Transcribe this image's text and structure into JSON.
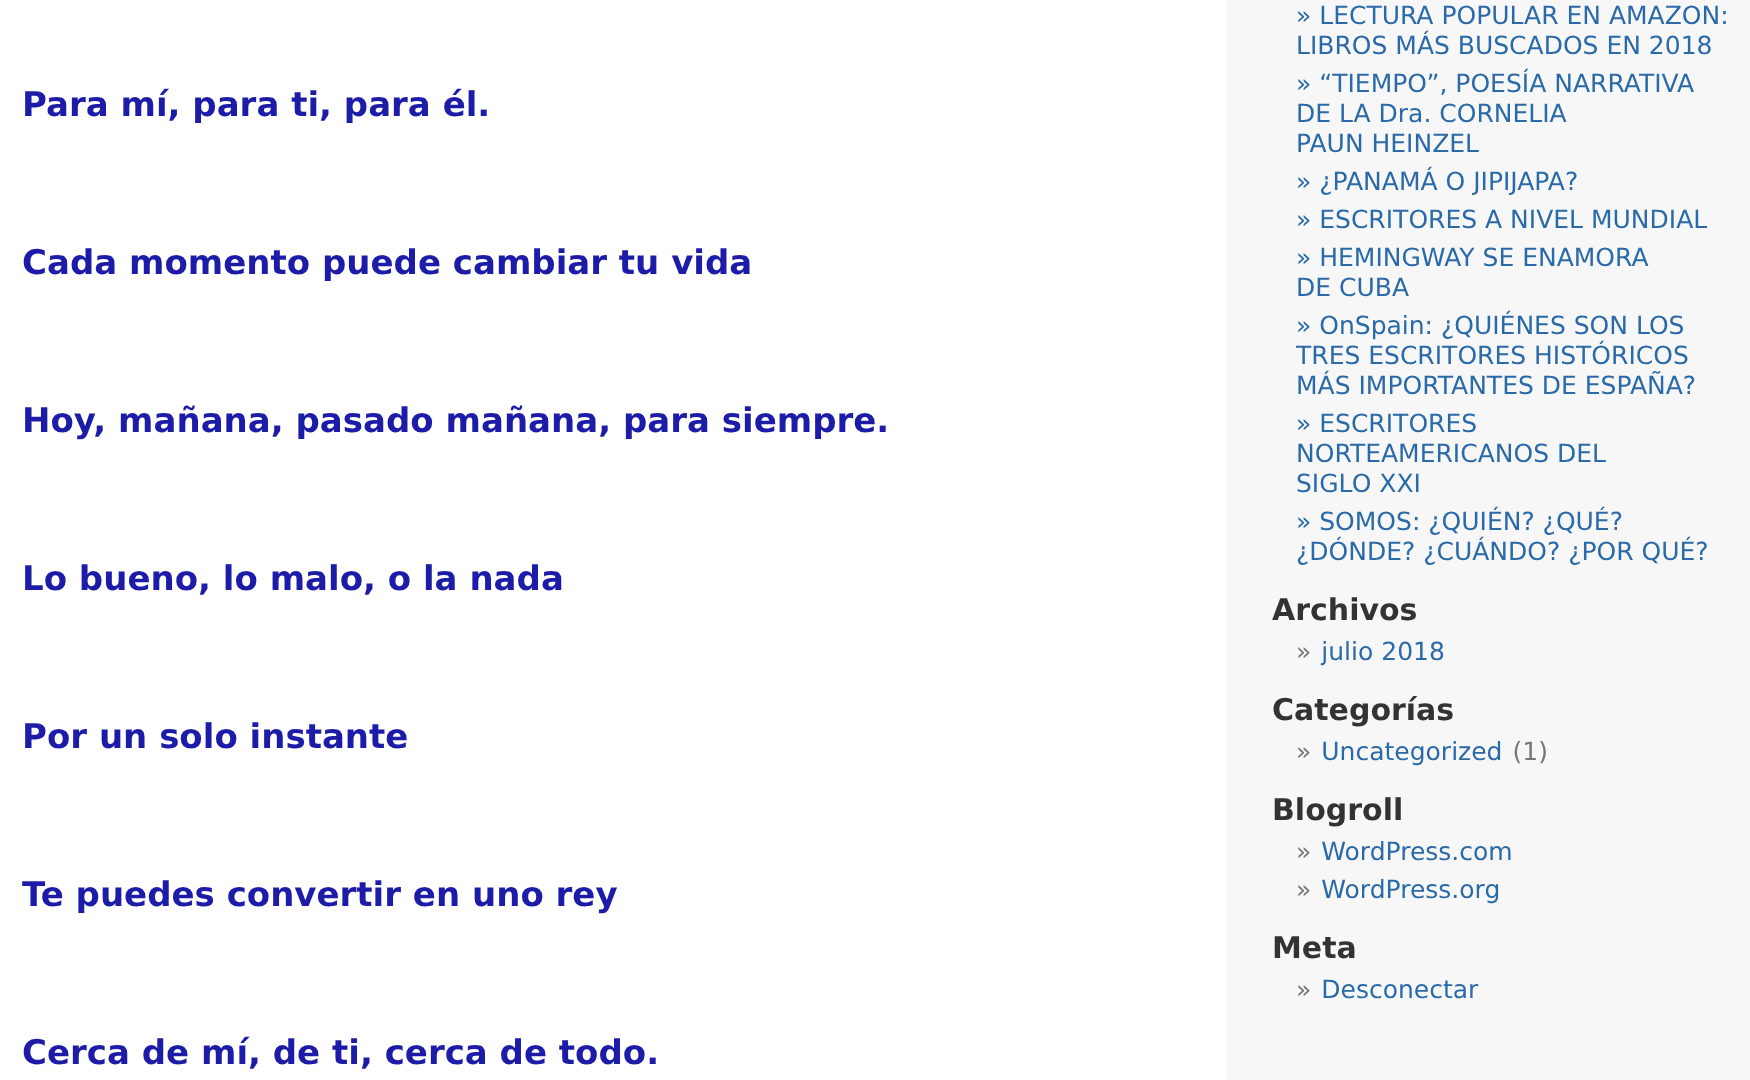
{
  "verses": [
    "Para mí, para ti, para él.",
    "Cada momento puede cambiar tu vida",
    "Hoy, mañana, pasado mañana, para siempre.",
    "Lo bueno, lo malo, o la nada",
    "Por un solo instante",
    "Te puedes convertir en uno rey",
    "Cerca de mí, de ti, cerca de todo."
  ],
  "sidebar": {
    "recent_posts": [
      {
        "lines": [
          "» LECTURA POPULAR EN AMAZON:",
          "LIBROS MÁS BUSCADOS EN 2018"
        ]
      },
      {
        "lines": [
          "» “TIEMPO”, POESÍA NARRATIVA",
          "DE LA Dra. CORNELIA",
          "PAUN HEINZEL"
        ]
      },
      {
        "lines": [
          "» ¿PANAMÁ O JIPIJAPA?"
        ]
      },
      {
        "lines": [
          "» ESCRITORES A NIVEL MUNDIAL"
        ]
      },
      {
        "lines": [
          "» HEMINGWAY SE ENAMORA",
          "DE CUBA"
        ]
      },
      {
        "lines": [
          "» OnSpain: ¿QUIÉNES SON LOS",
          "TRES ESCRITORES HISTÓRICOS",
          "MÁS IMPORTANTES DE ESPAÑA?"
        ]
      },
      {
        "lines": [
          "» ESCRITORES",
          "NORTEAMERICANOS DEL",
          "SIGLO XXI"
        ]
      },
      {
        "lines": [
          "» SOMOS: ¿QUIÉN? ¿QUÉ?",
          "¿DÓNDE? ¿CUÁNDO? ¿POR QUÉ?"
        ]
      }
    ],
    "sections": [
      {
        "title": "Archivos",
        "items": [
          {
            "bullet": "»",
            "label": "julio 2018"
          }
        ]
      },
      {
        "title": "Categorías",
        "items": [
          {
            "bullet": "»",
            "label": "Uncategorized",
            "count": "(1)"
          }
        ]
      },
      {
        "title": "Blogroll",
        "items": [
          {
            "bullet": "»",
            "label": "WordPress.com"
          },
          {
            "bullet": "»",
            "label": "WordPress.org"
          }
        ]
      },
      {
        "title": "Meta",
        "items": [
          {
            "bullet": "»",
            "label": "Desconectar"
          }
        ]
      }
    ]
  }
}
